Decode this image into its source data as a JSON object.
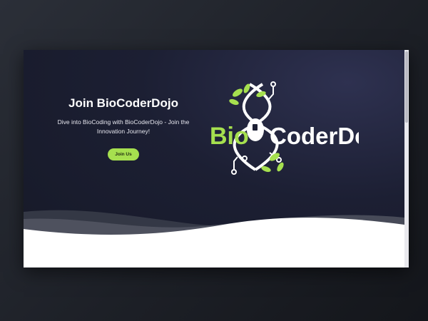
{
  "hero": {
    "title": "Join BioCoderDojo",
    "subtitle": "Dive into BioCoding with BioCoderDojo - Join the Innovation Journey!",
    "cta_label": "Join Us"
  },
  "logo": {
    "word_bio": "Bio",
    "word_coderdojo": "CoderDojo",
    "bio_color": "#a6e04f",
    "coderdojo_color": "#ffffff"
  },
  "colors": {
    "accent": "#a6e04f",
    "hero_background": "#1c1f33"
  }
}
